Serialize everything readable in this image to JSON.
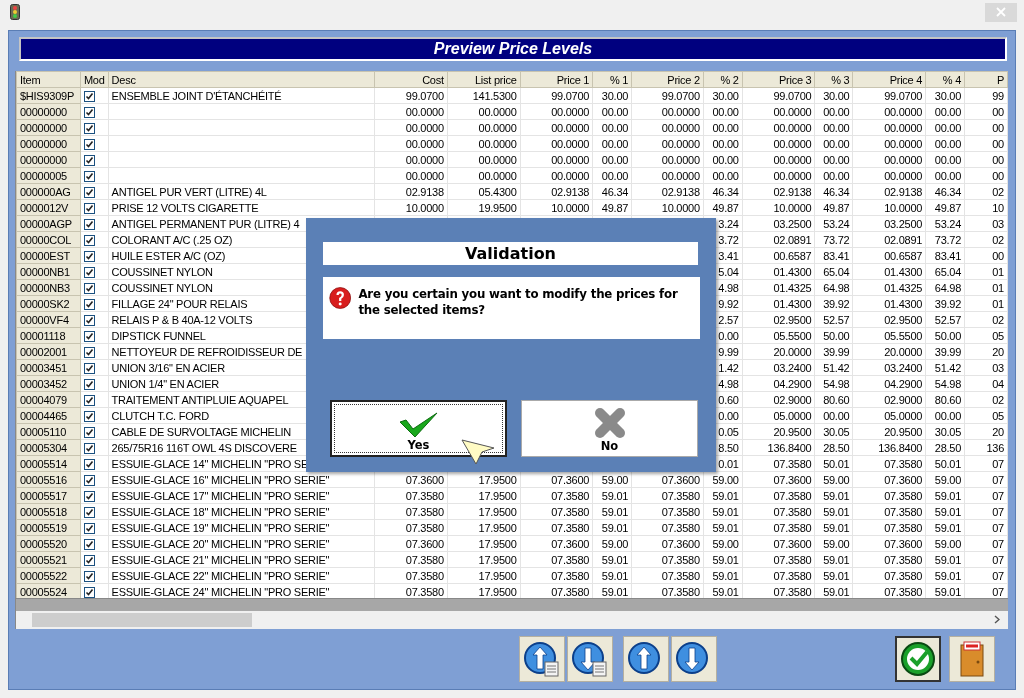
{
  "window": {
    "title": "Preview Price Levels"
  },
  "table": {
    "columns": [
      "Item",
      "Mod",
      "Desc",
      "Cost",
      "List price",
      "Price 1",
      "% 1",
      "Price 2",
      "% 2",
      "Price 3",
      "% 3",
      "Price 4",
      "% 4",
      "P"
    ],
    "rows": [
      {
        "item": "$HIS9309P",
        "mod": true,
        "desc": "ENSEMBLE JOINT D'ÉTANCHÉITÉ",
        "values": [
          "99.0700",
          "141.5300",
          "99.0700",
          "30.00",
          "99.0700",
          "30.00",
          "99.0700",
          "30.00",
          "99.0700",
          "30.00",
          "99"
        ]
      },
      {
        "item": "00000000",
        "mod": true,
        "values": [
          "00.0000",
          "00.0000",
          "00.0000",
          "00.00",
          "00.0000",
          "00.00",
          "00.0000",
          "00.00",
          "00.0000",
          "00.00",
          "00"
        ]
      },
      {
        "item": "00000000",
        "mod": true,
        "values": [
          "00.0000",
          "00.0000",
          "00.0000",
          "00.00",
          "00.0000",
          "00.00",
          "00.0000",
          "00.00",
          "00.0000",
          "00.00",
          "00"
        ]
      },
      {
        "item": "00000000",
        "mod": true,
        "values": [
          "00.0000",
          "00.0000",
          "00.0000",
          "00.00",
          "00.0000",
          "00.00",
          "00.0000",
          "00.00",
          "00.0000",
          "00.00",
          "00"
        ]
      },
      {
        "item": "00000000",
        "mod": true,
        "values": [
          "00.0000",
          "00.0000",
          "00.0000",
          "00.00",
          "00.0000",
          "00.00",
          "00.0000",
          "00.00",
          "00.0000",
          "00.00",
          "00"
        ]
      },
      {
        "item": "00000005",
        "mod": true,
        "values": [
          "00.0000",
          "00.0000",
          "00.0000",
          "00.00",
          "00.0000",
          "00.00",
          "00.0000",
          "00.00",
          "00.0000",
          "00.00",
          "00"
        ]
      },
      {
        "item": "000000AG",
        "mod": true,
        "desc": "ANTIGEL PUR VERT (LITRE)  4L",
        "values": [
          "02.9138",
          "05.4300",
          "02.9138",
          "46.34",
          "02.9138",
          "46.34",
          "02.9138",
          "46.34",
          "02.9138",
          "46.34",
          "02"
        ]
      },
      {
        "item": "0000012V",
        "mod": true,
        "desc": "PRISE 12 VOLTS CIGARETTE",
        "values": [
          "10.0000",
          "19.9500",
          "10.0000",
          "49.87",
          "10.0000",
          "49.87",
          "10.0000",
          "49.87",
          "10.0000",
          "49.87",
          "10"
        ]
      },
      {
        "item": "00000AGP",
        "mod": true,
        "desc": "ANTIGEL PERMANENT PUR (LITRE)  4",
        "values": [
          "3.24",
          "03.2500",
          "53.24",
          "03.2500",
          "53.24",
          "03"
        ]
      },
      {
        "item": "00000COL",
        "mod": true,
        "desc": "COLORANT A/C (.25 OZ)",
        "values": [
          "3.72",
          "02.0891",
          "73.72",
          "02.0891",
          "73.72",
          "02"
        ]
      },
      {
        "item": "00000EST",
        "mod": true,
        "desc": "HUILE ESTER A/C (OZ)",
        "values": [
          "3.41",
          "00.6587",
          "83.41",
          "00.6587",
          "83.41",
          "00"
        ]
      },
      {
        "item": "00000NB1",
        "mod": true,
        "desc": "COUSSINET NYLON",
        "values": [
          "5.04",
          "01.4300",
          "65.04",
          "01.4300",
          "65.04",
          "01"
        ]
      },
      {
        "item": "00000NB3",
        "mod": true,
        "desc": "COUSSINET NYLON",
        "values": [
          "4.98",
          "01.4325",
          "64.98",
          "01.4325",
          "64.98",
          "01"
        ]
      },
      {
        "item": "00000SK2",
        "mod": true,
        "desc": "FILLAGE 24\" POUR RELAIS",
        "values": [
          "9.92",
          "01.4300",
          "39.92",
          "01.4300",
          "39.92",
          "01"
        ]
      },
      {
        "item": "00000VF4",
        "mod": true,
        "desc": "RELAIS P & B 40A-12 VOLTS",
        "values": [
          "2.57",
          "02.9500",
          "52.57",
          "02.9500",
          "52.57",
          "02"
        ]
      },
      {
        "item": "00001118",
        "mod": true,
        "desc": "DIPSTICK FUNNEL",
        "values": [
          "0.00",
          "05.5500",
          "50.00",
          "05.5500",
          "50.00",
          "05"
        ]
      },
      {
        "item": "00002001",
        "mod": true,
        "desc": "NETTOYEUR DE REFROIDISSEUR DE",
        "values": [
          "9.99",
          "20.0000",
          "39.99",
          "20.0000",
          "39.99",
          "20"
        ]
      },
      {
        "item": "00003451",
        "mod": true,
        "desc": "UNION 3/16\" EN ACIER",
        "values": [
          "1.42",
          "03.2400",
          "51.42",
          "03.2400",
          "51.42",
          "03"
        ]
      },
      {
        "item": "00003452",
        "mod": true,
        "desc": "UNION 1/4\" EN ACIER",
        "values": [
          "4.98",
          "04.2900",
          "54.98",
          "04.2900",
          "54.98",
          "04"
        ]
      },
      {
        "item": "00004079",
        "mod": true,
        "desc": "TRAITEMENT ANTIPLUIE AQUAPEL",
        "values": [
          "0.60",
          "02.9000",
          "80.60",
          "02.9000",
          "80.60",
          "02"
        ]
      },
      {
        "item": "00004465",
        "mod": true,
        "desc": "CLUTCH T.C. FORD",
        "values": [
          "0.00",
          "05.0000",
          "00.00",
          "05.0000",
          "00.00",
          "05"
        ]
      },
      {
        "item": "00005110",
        "mod": true,
        "desc": "CABLE DE SURVOLTAGE MICHELIN",
        "values": [
          "0.05",
          "20.9500",
          "30.05",
          "20.9500",
          "30.05",
          "20"
        ]
      },
      {
        "item": "00005304",
        "mod": true,
        "desc": "265/75R16 116T OWL 4S DISCOVERE",
        "values": [
          "8.50",
          "136.8400",
          "28.50",
          "136.8400",
          "28.50",
          "136"
        ]
      },
      {
        "item": "00005514",
        "mod": true,
        "desc": "ESSUIE-GLACE 14\" MICHELIN \"PRO SE",
        "values": [
          "0.01",
          "07.3580",
          "50.01",
          "07.3580",
          "50.01",
          "07"
        ]
      },
      {
        "item": "00005516",
        "mod": true,
        "desc": "ESSUIE-GLACE 16\" MICHELIN \"PRO SERIE\"",
        "values": [
          "07.3600",
          "17.9500",
          "07.3600",
          "59.00",
          "07.3600",
          "59.00",
          "07.3600",
          "59.00",
          "07.3600",
          "59.00",
          "07"
        ]
      },
      {
        "item": "00005517",
        "mod": true,
        "desc": "ESSUIE-GLACE 17\" MICHELIN \"PRO SERIE\"",
        "values": [
          "07.3580",
          "17.9500",
          "07.3580",
          "59.01",
          "07.3580",
          "59.01",
          "07.3580",
          "59.01",
          "07.3580",
          "59.01",
          "07"
        ]
      },
      {
        "item": "00005518",
        "mod": true,
        "desc": "ESSUIE-GLACE 18\" MICHELIN \"PRO SERIE\"",
        "values": [
          "07.3580",
          "17.9500",
          "07.3580",
          "59.01",
          "07.3580",
          "59.01",
          "07.3580",
          "59.01",
          "07.3580",
          "59.01",
          "07"
        ]
      },
      {
        "item": "00005519",
        "mod": true,
        "desc": "ESSUIE-GLACE 19\" MICHELIN \"PRO SERIE\"",
        "values": [
          "07.3580",
          "17.9500",
          "07.3580",
          "59.01",
          "07.3580",
          "59.01",
          "07.3580",
          "59.01",
          "07.3580",
          "59.01",
          "07"
        ]
      },
      {
        "item": "00005520",
        "mod": true,
        "desc": "ESSUIE-GLACE 20\" MICHELIN \"PRO SERIE\"",
        "values": [
          "07.3600",
          "17.9500",
          "07.3600",
          "59.00",
          "07.3600",
          "59.00",
          "07.3600",
          "59.00",
          "07.3600",
          "59.00",
          "07"
        ]
      },
      {
        "item": "00005521",
        "mod": true,
        "desc": "ESSUIE-GLACE 21\" MICHELIN \"PRO SERIE\"",
        "values": [
          "07.3580",
          "17.9500",
          "07.3580",
          "59.01",
          "07.3580",
          "59.01",
          "07.3580",
          "59.01",
          "07.3580",
          "59.01",
          "07"
        ]
      },
      {
        "item": "00005522",
        "mod": true,
        "desc": "ESSUIE-GLACE 22\" MICHELIN \"PRO SERIE\"",
        "values": [
          "07.3580",
          "17.9500",
          "07.3580",
          "59.01",
          "07.3580",
          "59.01",
          "07.3580",
          "59.01",
          "07.3580",
          "59.01",
          "07"
        ]
      },
      {
        "item": "00005524",
        "mod": true,
        "desc": "ESSUIE-GLACE 24\" MICHELIN \"PRO SERIE\"",
        "values": [
          "07.3580",
          "17.9500",
          "07.3580",
          "59.01",
          "07.3580",
          "59.01",
          "07.3580",
          "59.01",
          "07.3580",
          "59.01",
          "07"
        ]
      }
    ]
  },
  "dialog": {
    "title": "Validation",
    "message": "Are you certain you want to modify the prices for the selected items?",
    "buttons": [
      {
        "kind": "yes",
        "label": "Yes",
        "focused": true
      },
      {
        "kind": "no",
        "label": "No",
        "focused": false
      }
    ]
  }
}
